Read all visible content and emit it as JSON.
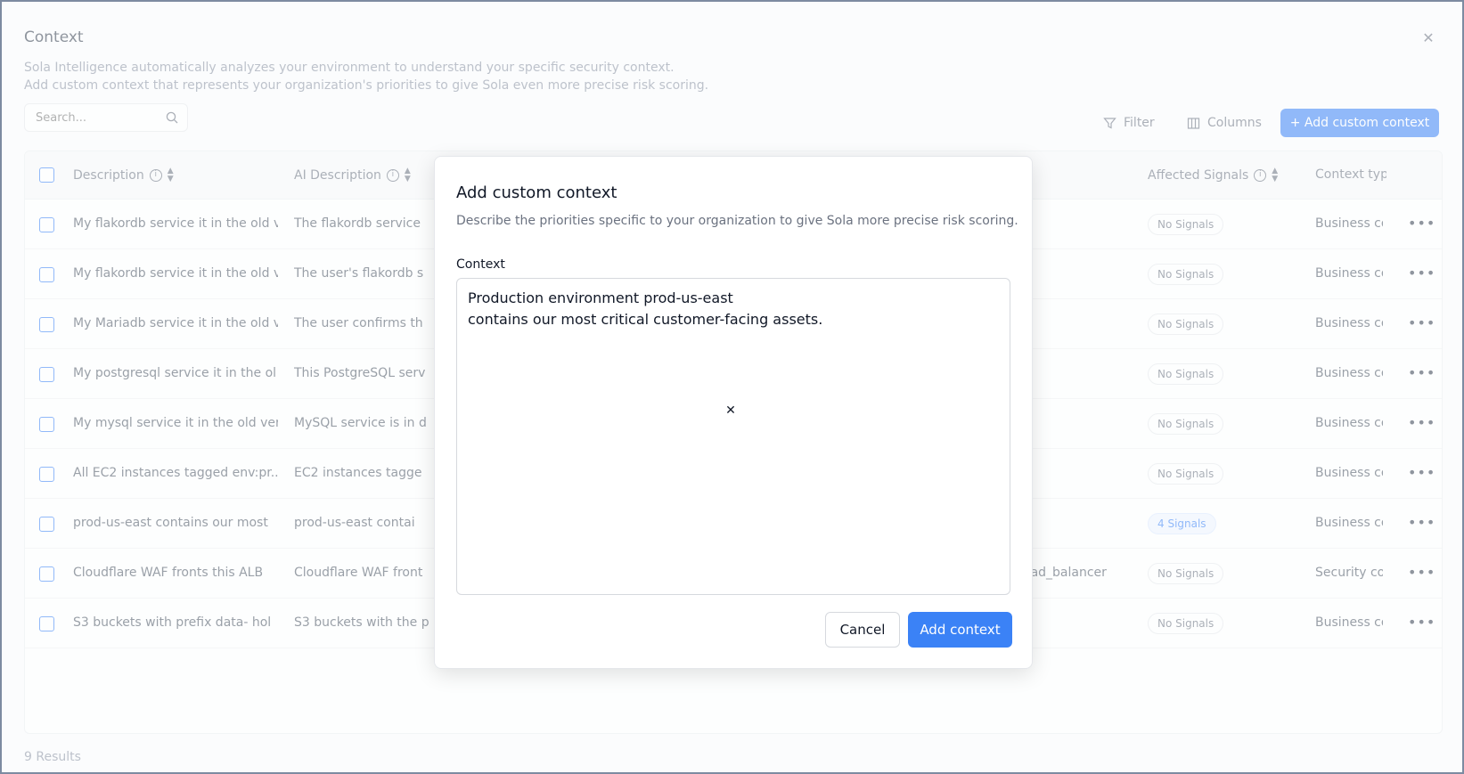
{
  "page": {
    "title": "Context",
    "description_line1": "Sola Intelligence automatically analyzes your environment to understand your specific security context.",
    "description_line2": "Add custom context that represents your organization's priorities to give Sola even more precise risk scoring.",
    "search_placeholder": "Search...",
    "filter_label": "Filter",
    "columns_label": "Columns",
    "add_button_label": "+ Add custom context",
    "results_label": "9 Results"
  },
  "table": {
    "headers": {
      "description": "Description",
      "ai_description": "AI Description",
      "affected_signals": "Affected Signals",
      "context_type": "Context typ"
    },
    "rows": [
      {
        "description": "My flakordb service it in the old v",
        "ai": "The flakordb service",
        "extra": "",
        "signals": "No Signals",
        "type": "Business co"
      },
      {
        "description": "My flakordb service it in the old v",
        "ai": "The user's flakordb s",
        "extra": "",
        "signals": "No Signals",
        "type": "Business co"
      },
      {
        "description": "My Mariadb service it in the old v",
        "ai": "The user confirms th",
        "extra": "",
        "signals": "No Signals",
        "type": "Business co"
      },
      {
        "description": "My postgresql service it in the ol",
        "ai": "This PostgreSQL serv",
        "extra": "",
        "signals": "No Signals",
        "type": "Business co"
      },
      {
        "description": "My mysql service it in the old ver",
        "ai": "MySQL service is in d",
        "extra": "",
        "signals": "No Signals",
        "type": "Business co"
      },
      {
        "description": "All EC2 instances tagged env:pr...",
        "ai": "EC2 instances tagge",
        "extra": "",
        "signals": "No Signals",
        "type": "Business co"
      },
      {
        "description": "prod-us-east contains our most",
        "ai": "prod-us-east contai",
        "extra": "",
        "signals": "4 Signals",
        "type": "Business co"
      },
      {
        "description": "Cloudflare WAF fronts this ALB",
        "ai": "Cloudflare WAF front",
        "extra": "oad_balancer",
        "signals": "No Signals",
        "type": "Security co"
      },
      {
        "description": "S3 buckets with prefix data- hol",
        "ai": "S3 buckets with the p",
        "extra": "",
        "signals": "No Signals",
        "type": "Business co"
      }
    ]
  },
  "modal": {
    "title": "Add custom context",
    "subtitle": "Describe the priorities specific to your organization to give Sola more precise risk scoring.",
    "field_label": "Context",
    "field_value": "Production environment prod-us-east\ncontains our most critical customer-facing assets.",
    "cancel_label": "Cancel",
    "submit_label": "Add context"
  }
}
